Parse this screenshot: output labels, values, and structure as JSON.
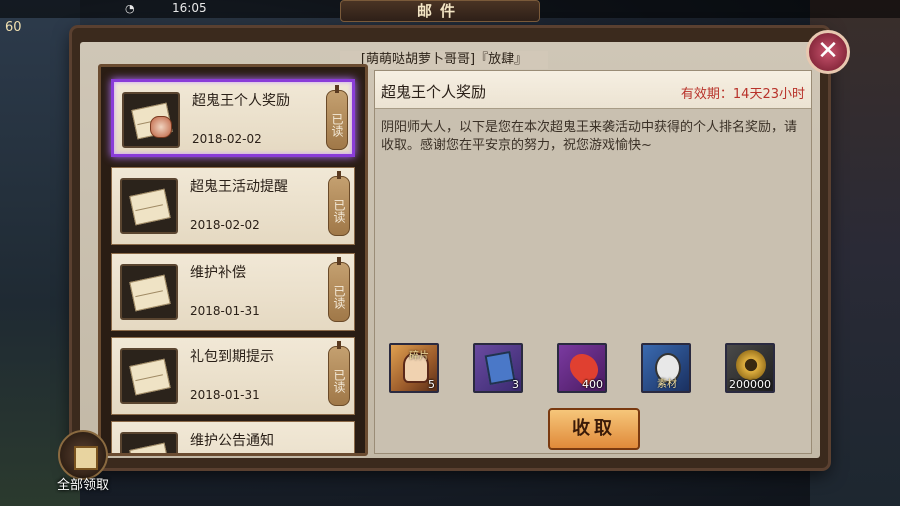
{
  "status_bar": {
    "level": "60",
    "time": "16:05"
  },
  "title": "邮件",
  "subtitle": "[萌萌哒胡萝卜哥哥]『放肆』",
  "close_symbol": "✕",
  "mail_list": [
    {
      "title": "超鬼王个人奖励",
      "date": "2018-02-02",
      "read_label": "已读",
      "selected": true
    },
    {
      "title": "超鬼王活动提醒",
      "date": "2018-02-02",
      "read_label": "已读",
      "selected": false
    },
    {
      "title": "维护补偿",
      "date": "2018-01-31",
      "read_label": "已读",
      "selected": false
    },
    {
      "title": "礼包到期提示",
      "date": "2018-01-31",
      "read_label": "已读",
      "selected": false
    },
    {
      "title": "维护公告通知",
      "date": "",
      "read_label": "",
      "selected": false
    }
  ],
  "detail": {
    "title": "超鬼王个人奖励",
    "expiry": "有效期：14天23小时",
    "body": "阴阳师大人，以下是您在本次超鬼王来袭活动中获得的个人排名奖励，请收取。感谢您在平安京的努力，祝您游戏愉快~"
  },
  "rewards": [
    {
      "icon": "shard-icon",
      "tag": "碎片",
      "count": "5"
    },
    {
      "icon": "scroll-icon",
      "tag": "",
      "count": "3"
    },
    {
      "icon": "red-item-icon",
      "tag": "",
      "count": "400"
    },
    {
      "icon": "daruma-material-icon",
      "tag": "素材",
      "count": ""
    },
    {
      "icon": "coin-icon",
      "tag": "",
      "count": "200000"
    }
  ],
  "collect_button": "收取",
  "collect_all_button": "全部领取",
  "colors": {
    "selected_border": "#8a3cd8",
    "expiry_text": "#b8322a",
    "collect_button": "#f0a050"
  }
}
